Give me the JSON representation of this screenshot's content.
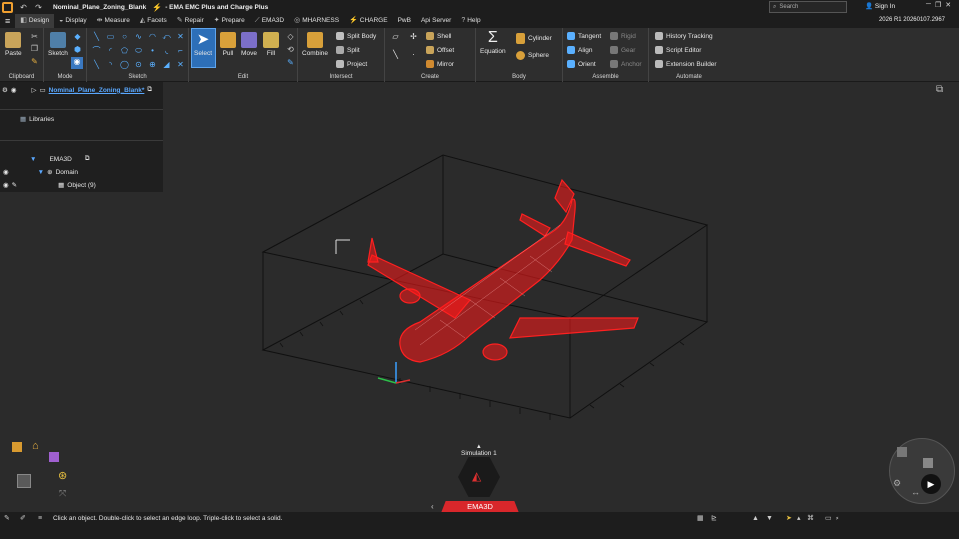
{
  "window": {
    "file": "Nominal_Plane_Zoning_Blank",
    "app": "- EMA EMC Plus and Charge Plus",
    "search_placeholder": "Search",
    "signin": "Sign In",
    "version": "2026 R1 20260107.2967"
  },
  "tabs": [
    "Design",
    "Display",
    "Measure",
    "Facets",
    "Repair",
    "Prepare",
    "EMA3D",
    "MHARNESS",
    "CHARGE",
    "PwB",
    "Api Server",
    "Help"
  ],
  "ribbon": {
    "groups": [
      "Clipboard",
      "Mode",
      "Sketch",
      "Edit",
      "Intersect",
      "Create",
      "Body",
      "Assemble",
      "Automate"
    ],
    "paste": "Paste",
    "sketch": "Sketch",
    "select": "Select",
    "pull": "Pull",
    "move": "Move",
    "fill": "Fill",
    "combine": "Combine",
    "split_body": "Split Body",
    "split": "Split",
    "project": "Project",
    "shell": "Shell",
    "offset": "Offset",
    "mirror": "Mirror",
    "equation": "Equation",
    "cylinder": "Cylinder",
    "sphere": "Sphere",
    "tangent": "Tangent",
    "align": "Align",
    "orient": "Orient",
    "rigid": "Rigid",
    "gear": "Gear",
    "anchor": "Anchor",
    "history_tracking": "History Tracking",
    "script_editor": "Script Editor",
    "extension_builder": "Extension Builder"
  },
  "tree": {
    "root": "Nominal_Plane_Zoning_Blank*",
    "libraries": "Libraries",
    "ema3d": "EMA3D",
    "domain": "Domain",
    "object": "Object (9)"
  },
  "viewport": {
    "simulation": "Simulation 1",
    "bottom_tab": "EMA3D",
    "accent": "#d8272b"
  },
  "status": {
    "hint": "Click an object. Double-click to select an edge loop. Triple-click to select a solid."
  }
}
